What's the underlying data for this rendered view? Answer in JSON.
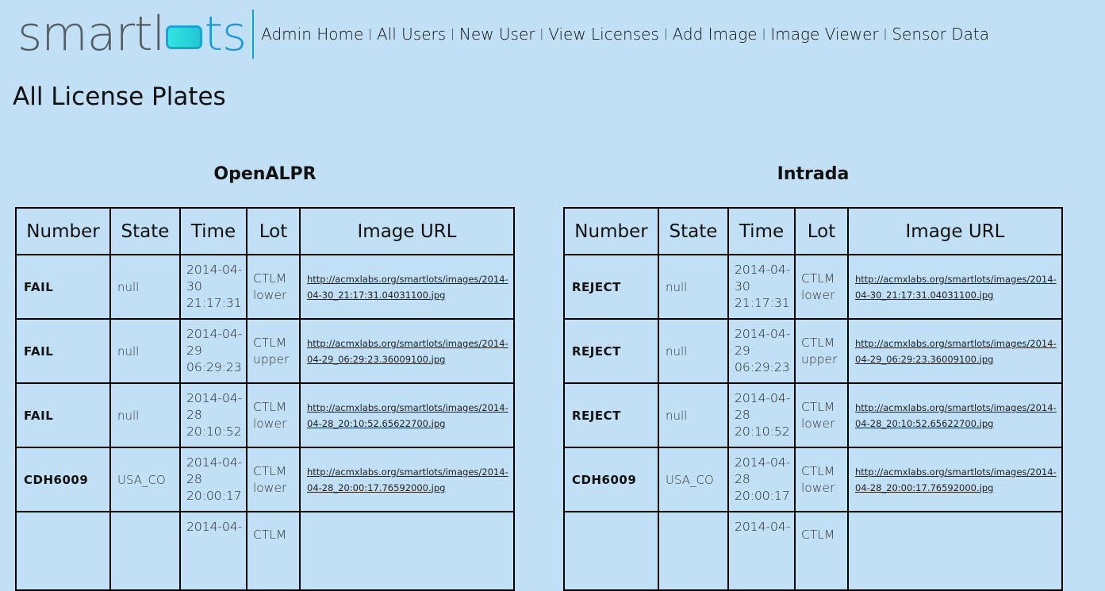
{
  "logo": {
    "smart": "smartl",
    "ts": "ts"
  },
  "nav": [
    "Admin Home",
    "All Users",
    "New User",
    "View Licenses",
    "Add Image",
    "Image Viewer",
    "Sensor Data"
  ],
  "nav_separator": "|",
  "page_title": "All License Plates",
  "columns": [
    "Number",
    "State",
    "Time",
    "Lot",
    "Image URL"
  ],
  "openalpr": {
    "title": "OpenALPR",
    "rows": [
      {
        "number": "FAIL",
        "state": "null",
        "time": "2014-04-30 21:17:31",
        "lot": "CTLM lower",
        "url": "http://acmxlabs.org/smartlots/images/2014-04-30_21:17:31.04031100.jpg"
      },
      {
        "number": "FAIL",
        "state": "null",
        "time": "2014-04-29 06:29:23",
        "lot": "CTLM upper",
        "url": "http://acmxlabs.org/smartlots/images/2014-04-29_06:29:23.36009100.jpg"
      },
      {
        "number": "FAIL",
        "state": "null",
        "time": "2014-04-28 20:10:52",
        "lot": "CTLM lower",
        "url": "http://acmxlabs.org/smartlots/images/2014-04-28_20:10:52.65622700.jpg"
      },
      {
        "number": "CDH6009",
        "state": "USA_CO",
        "time": "2014-04-28 20:00:17",
        "lot": "CTLM lower",
        "url": "http://acmxlabs.org/smartlots/images/2014-04-28_20:00:17.76592000.jpg"
      },
      {
        "number": "",
        "state": "",
        "time": "2014-04-",
        "lot": "CTLM",
        "url": ""
      }
    ]
  },
  "intrada": {
    "title": "Intrada",
    "rows": [
      {
        "number": "REJECT",
        "state": "null",
        "time": "2014-04-30 21:17:31",
        "lot": "CTLM lower",
        "url": "http://acmxlabs.org/smartlots/images/2014-04-30_21:17:31.04031100.jpg"
      },
      {
        "number": "REJECT",
        "state": "null",
        "time": "2014-04-29 06:29:23",
        "lot": "CTLM upper",
        "url": "http://acmxlabs.org/smartlots/images/2014-04-29_06:29:23.36009100.jpg"
      },
      {
        "number": "REJECT",
        "state": "null",
        "time": "2014-04-28 20:10:52",
        "lot": "CTLM lower",
        "url": "http://acmxlabs.org/smartlots/images/2014-04-28_20:10:52.65622700.jpg"
      },
      {
        "number": "CDH6009",
        "state": "USA_CO",
        "time": "2014-04-28 20:00:17",
        "lot": "CTLM lower",
        "url": "http://acmxlabs.org/smartlots/images/2014-04-28_20:00:17.76592000.jpg"
      },
      {
        "number": "",
        "state": "",
        "time": "2014-04-",
        "lot": "CTLM",
        "url": ""
      }
    ]
  }
}
